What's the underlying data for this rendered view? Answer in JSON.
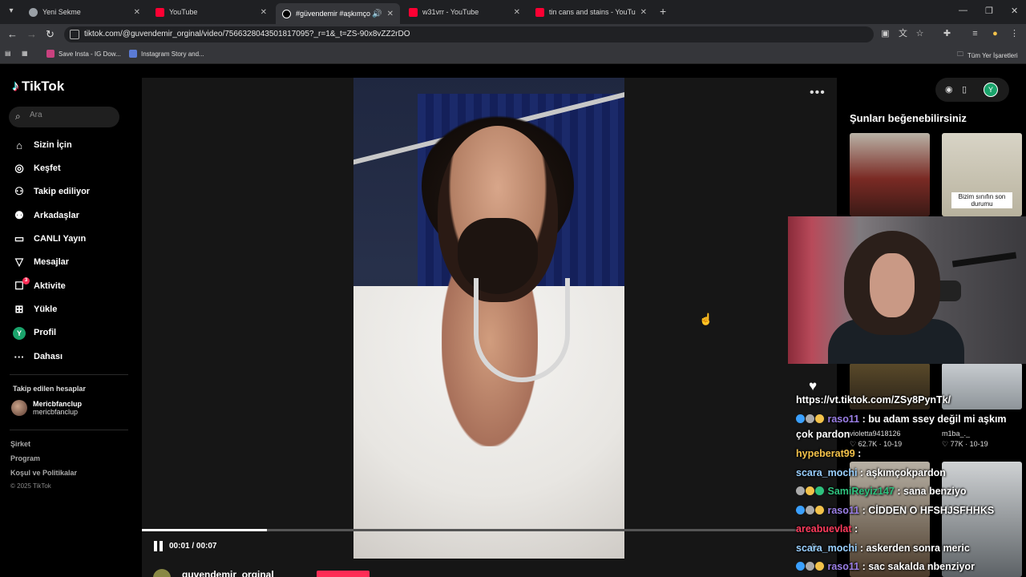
{
  "browser": {
    "tabs": [
      {
        "title": "Yeni Sekme",
        "color": "#9aa0a6"
      },
      {
        "title": "YouTube",
        "color": "#ff0033"
      },
      {
        "title": "#güvendemir #aşkımçokpa",
        "color": "#ffffff"
      },
      {
        "title": "w31vrr - YouTube",
        "color": "#ff0033"
      },
      {
        "title": "tin cans and stains - YouTube",
        "color": "#ff0033"
      }
    ],
    "url": "tiktok.com/@guvendemir_orginal/video/7566328043501817095?_r=1&_t=ZS-90x8vZZ2rDO",
    "bookmarks": [
      "Save Insta - IG Dow...",
      "Instagram Story and...",
      "Tüm Yer İşaretleri"
    ]
  },
  "tiktok": {
    "logo": "TikTok",
    "search_placeholder": "Ara",
    "nav": [
      {
        "label": "Sizin İçin",
        "icon": "home-icon"
      },
      {
        "label": "Keşfet",
        "icon": "compass-icon"
      },
      {
        "label": "Takip ediliyor",
        "icon": "following-icon"
      },
      {
        "label": "Arkadaşlar",
        "icon": "friends-icon"
      },
      {
        "label": "CANLI Yayın",
        "icon": "live-icon"
      },
      {
        "label": "Mesajlar",
        "icon": "messages-icon"
      },
      {
        "label": "Aktivite",
        "icon": "activity-icon",
        "badge": "3"
      },
      {
        "label": "Yükle",
        "icon": "upload-icon"
      },
      {
        "label": "Profil",
        "icon": "profile-avatar",
        "avatar_letter": "Y"
      },
      {
        "label": "Dahası",
        "icon": "more-icon"
      }
    ],
    "followed_title": "Takip edilen hesaplar",
    "followed": {
      "name": "Mericbfanclup",
      "handle": "mericbfanclup"
    },
    "footer": [
      "Şirket",
      "Program",
      "Koşul ve Politikalar"
    ],
    "copyright": "© 2025 TikTok"
  },
  "player": {
    "time": "00:01 / 00:07",
    "progress": 0.19,
    "author": "guvendemir_orginal"
  },
  "right": {
    "title": "Şunları beğenebilirsiniz",
    "caption": "Bizim sınıfın son durumu",
    "avatar_letter": "Y",
    "items": [
      {
        "user": "violetta9418126",
        "likes": "62.7K",
        "date": "10-19"
      },
      {
        "user": "m1ba_._",
        "likes": "77K",
        "date": "10-19"
      }
    ]
  },
  "chat": {
    "link": "https://vt.tiktok.com/ZSy8PynTk/",
    "lines": [
      {
        "user": "raso11",
        "user_color": "#9b7fe6",
        "text": ": bu adam ssey değil mi aşkım"
      },
      {
        "user": "",
        "user_color": "#ffffff",
        "text": "çok pardon"
      },
      {
        "user": "hypeberat99",
        "user_color": "#f3c24a",
        "text": ":"
      },
      {
        "user": "scara_mochi",
        "user_color": "#9ad0ff",
        "text": ": aşkımçokpardon"
      },
      {
        "user": "SamiReyiz147",
        "user_color": "#2ec27e",
        "text": ": sana benziyo"
      },
      {
        "user": "raso11",
        "user_color": "#9b7fe6",
        "text": ": CİDDEN O HFSHJSFHHKS"
      },
      {
        "user": "areabuevlat",
        "user_color": "#ff3b5c",
        "text": ":"
      },
      {
        "user": "scara_mochi",
        "user_color": "#9ad0ff",
        "text": ": askerden sonra meric"
      },
      {
        "user": "raso11",
        "user_color": "#9b7fe6",
        "text": ": sac sakalda nbenziyor"
      }
    ]
  },
  "colors": {
    "accent": "#fe2c55",
    "background": "#000000",
    "avatar": "#1aa36b"
  }
}
